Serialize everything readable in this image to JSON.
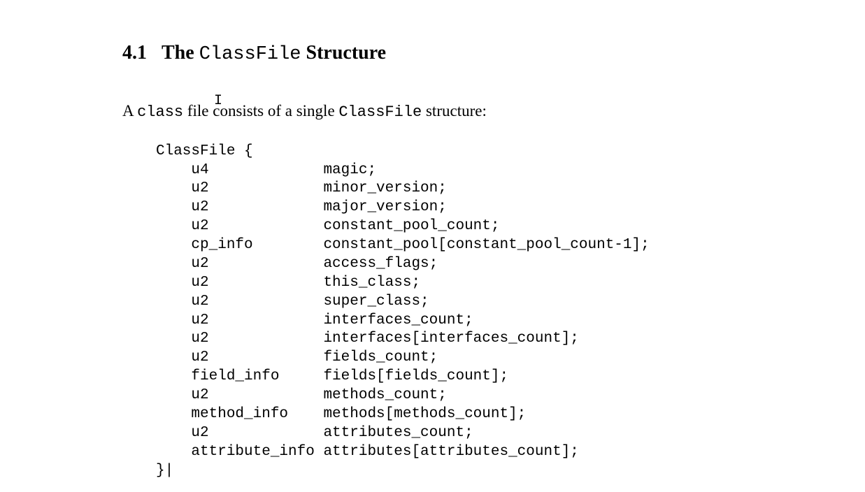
{
  "heading": {
    "number": "4.1",
    "before_mono": "The ",
    "mono": "ClassFile",
    "after_mono": " Structure"
  },
  "intro": {
    "t1": "A ",
    "m1": "class",
    "t2": " file consists of a single ",
    "m2": "ClassFile",
    "t3": " structure:"
  },
  "code": {
    "open": "ClassFile {",
    "close": "}",
    "fields": [
      {
        "type": "u4",
        "name": "magic;"
      },
      {
        "type": "u2",
        "name": "minor_version;"
      },
      {
        "type": "u2",
        "name": "major_version;"
      },
      {
        "type": "u2",
        "name": "constant_pool_count;"
      },
      {
        "type": "cp_info",
        "name": "constant_pool[constant_pool_count-1];"
      },
      {
        "type": "u2",
        "name": "access_flags;"
      },
      {
        "type": "u2",
        "name": "this_class;"
      },
      {
        "type": "u2",
        "name": "super_class;"
      },
      {
        "type": "u2",
        "name": "interfaces_count;"
      },
      {
        "type": "u2",
        "name": "interfaces[interfaces_count];"
      },
      {
        "type": "u2",
        "name": "fields_count;"
      },
      {
        "type": "field_info",
        "name": "fields[fields_count];"
      },
      {
        "type": "u2",
        "name": "methods_count;"
      },
      {
        "type": "method_info",
        "name": "methods[methods_count];"
      },
      {
        "type": "u2",
        "name": "attributes_count;"
      },
      {
        "type": "attribute_info",
        "name": "attributes[attributes_count];"
      }
    ]
  },
  "cursor": "I"
}
